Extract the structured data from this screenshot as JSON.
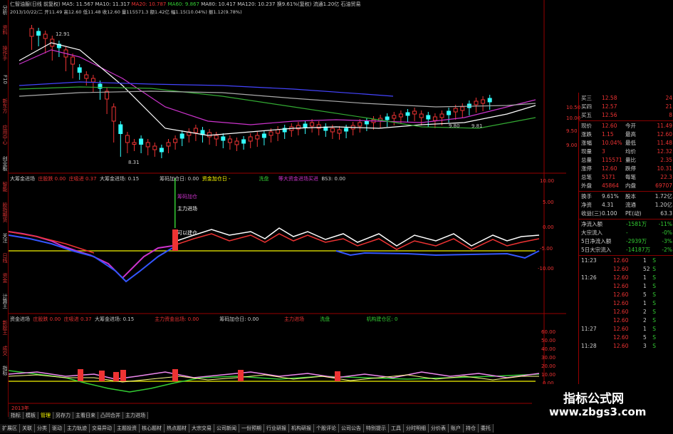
{
  "header": {
    "stock": "仁智油服(日线 前复权)",
    "ma5": "MA5: 11.567",
    "ma10": "MA10: 11.317",
    "ma20": "MA20: 10.787",
    "ma60": "MA60: 9.867",
    "ma80": "MA80: 10.417",
    "ma120": "MA120: 10.237",
    "turnover": "换9.61%(复权)",
    "float": "流通1.20亿 石油贸易",
    "date_line": "2013/10/22/二 开11.49 高12.60 低11.48 收12.60 量115571.3 额1.42亿 幅1.15(10.04%) 振1.12(9.78%)"
  },
  "left_tabs": [
    "分析",
    "资料",
    "操作手",
    "F10",
    "新东方",
    "应用中心",
    "创业板",
    "智能",
    "股指期货",
    "关注",
    "日线",
    "资金",
    "计算王",
    "新股王",
    "成交",
    "指标"
  ],
  "price_labels": {
    "high": "12.91",
    "low": "8.31",
    "mid_left": "9.80",
    "mid_right": "9.81"
  },
  "panel2": {
    "title": "大筹金进场",
    "items": [
      "庄股跌 0.00",
      "庄吸进 0.37",
      "大筹金进场: 0.15",
      "",
      "筹码加仓日: 0.00",
      "资金加仓日 -",
      "",
      "洗盘",
      "等大资金进场买进",
      "BS3: 0.00"
    ],
    "annot": [
      "筹码加仓",
      "主力进场",
      "可以建仓"
    ],
    "yticks": [
      "10.00",
      "5.00",
      "0.00",
      "-5.00",
      "-10.00"
    ]
  },
  "panel3": {
    "title": "资金进场",
    "items": [
      "庄股跌 0.00",
      "庄吸进 0.37",
      "大筹金进场: 0.15",
      "",
      "主力资金出场: 0.00",
      "",
      "筹码加仓日: 0.00",
      "主力进场",
      "",
      "洗盘",
      "",
      "机构建仓区: 0"
    ],
    "yticks": [
      "60.00",
      "50.00",
      "40.00",
      "30.00",
      "20.00",
      "10.00",
      "0.00"
    ]
  },
  "right_axis": [
    "10.50",
    "10.00",
    "9.50",
    "9.00"
  ],
  "quote": {
    "asks": [
      [
        "买三",
        "12.58",
        "24"
      ],
      [
        "买四",
        "12.57",
        "21"
      ],
      [
        "买五",
        "12.56",
        "8"
      ]
    ],
    "rows": [
      [
        "现价",
        "12.60",
        "今开",
        "11.49"
      ],
      [
        "涨跌",
        "1.15",
        "最高",
        "12.60"
      ],
      [
        "涨幅",
        "10.04%",
        "最低",
        "11.48"
      ],
      [
        "现量",
        "3",
        "均价",
        "12.32"
      ],
      [
        "总量",
        "115571",
        "量比",
        "2.35"
      ],
      [
        "涨停",
        "12.60",
        "跌停",
        "10.31"
      ],
      [
        "总笔",
        "5171",
        "每笔",
        "22.3"
      ],
      [
        "外盘",
        "45864",
        "内盘",
        "69707"
      ]
    ],
    "rows2": [
      [
        "换手",
        "9.61%",
        "股本",
        "1.72亿"
      ],
      [
        "净资",
        "4.31",
        "流通",
        "1.20亿"
      ],
      [
        "收益(三)",
        "0.100",
        "PE(动)",
        "63.3"
      ]
    ],
    "flows": [
      [
        "净流入额",
        "-1581万",
        "-11%"
      ],
      [
        "大宗流入",
        "-",
        "-0%"
      ],
      [
        "5日净流入额",
        "-2939万",
        "-3%"
      ],
      [
        "5日大宗流入",
        "-14187万",
        "-2%"
      ]
    ],
    "ticks": [
      [
        "11:23",
        "12.60",
        "1",
        "S"
      ],
      [
        "",
        "12.60",
        "52",
        "S"
      ],
      [
        "11:26",
        "12.60",
        "1",
        "S"
      ],
      [
        "",
        "12.60",
        "1",
        "S"
      ],
      [
        "",
        "12.60",
        "5",
        "S"
      ],
      [
        "",
        "12.60",
        "1",
        "S"
      ],
      [
        "",
        "12.60",
        "2",
        "S"
      ],
      [
        "",
        "12.60",
        "2",
        "S"
      ],
      [
        "11:27",
        "12.60",
        "1",
        "S"
      ],
      [
        "",
        "12.60",
        "5",
        "S"
      ],
      [
        "11:28",
        "12.60",
        "3",
        "S"
      ]
    ]
  },
  "year": "2013年",
  "tabs_row1": [
    "指标",
    "模板",
    "管理",
    "另存力",
    "主看日来",
    "凸凹合并",
    "主力进场"
  ],
  "tabs_row2": [
    "扩展区",
    "关联",
    "分类",
    "驱动",
    "主力轨迹",
    "交易异动",
    "主题投资",
    "核心题材",
    "热点题材",
    "大宗交易",
    "公司新闻",
    "一份预期",
    "行业研报",
    "机构研报",
    "个股评论",
    "公司公告",
    "特别提示",
    "工具",
    "分时明细",
    "分价表",
    "账户",
    "持仓",
    "委托"
  ],
  "watermark": {
    "title": "指标公式网",
    "url": "www.zbgs3.com"
  }
}
